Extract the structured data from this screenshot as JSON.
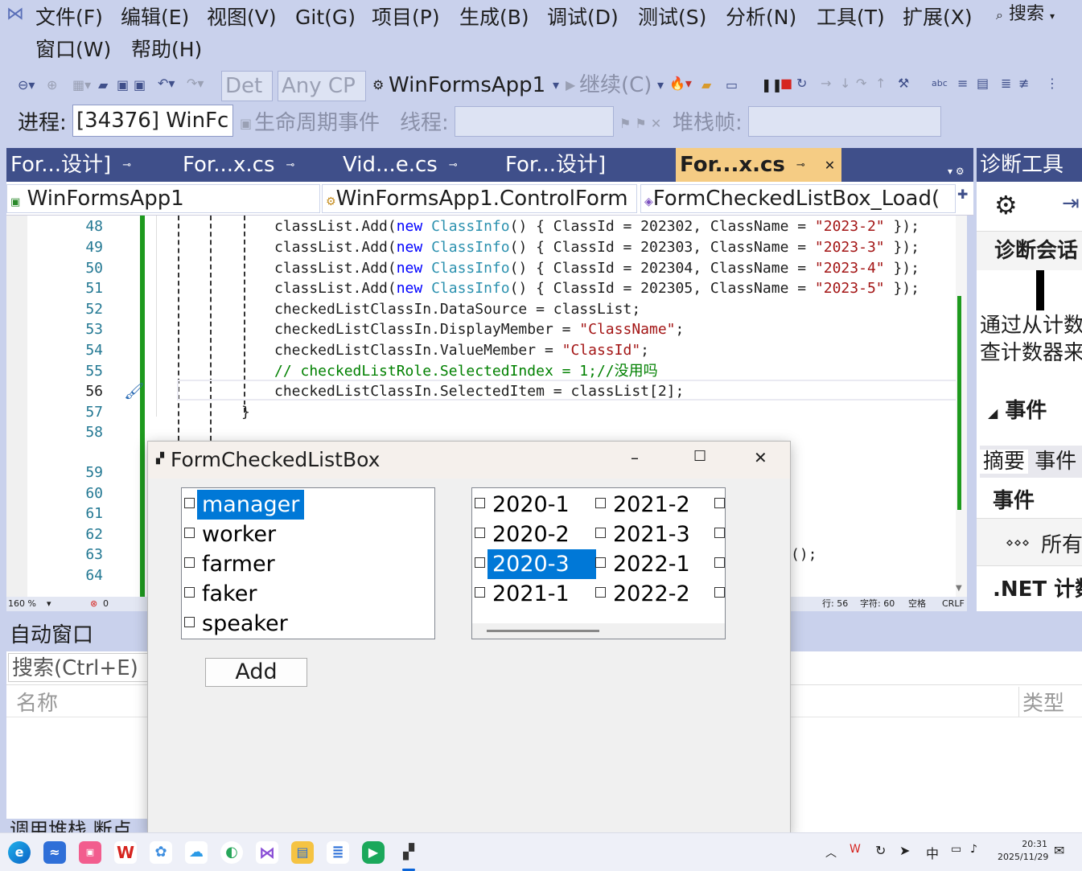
{
  "menu": {
    "items": [
      "文件(F)",
      "编辑(E)",
      "视图(V)",
      "Git(G)",
      "项目(P)",
      "生成(B)",
      "调试(D)",
      "测试(S)",
      "分析(N)",
      "工具(T)",
      "扩展(X)",
      "窗口(W)",
      "帮助(H)"
    ],
    "search": "搜索"
  },
  "toolbar": {
    "config": "Det",
    "platform": "Any CP",
    "project": "WinFormsApp1",
    "continue": "继续(C)",
    "process_label": "进程:",
    "process_value": "[34376] WinFc",
    "lifecycle": "生命周期事件",
    "thread_label": "线程:",
    "stack_label": "堆栈帧:"
  },
  "tabs": [
    {
      "label": "For...设计]"
    },
    {
      "label": "For...x.cs"
    },
    {
      "label": "Vid...e.cs"
    },
    {
      "label": "For...设计]"
    },
    {
      "label": "For...x.cs"
    }
  ],
  "nav": {
    "project": "WinFormsApp1",
    "class": "WinFormsApp1.ControlForm",
    "member": "FormCheckedListBox_Load("
  },
  "editor": {
    "line_numbers": [
      "48",
      "49",
      "50",
      "51",
      "52",
      "53",
      "54",
      "55",
      "56",
      "57",
      "58",
      "59",
      "60",
      "61",
      "62",
      "63",
      "64"
    ],
    "lines": [
      {
        "a": "classList.Add(",
        "kw": "new",
        "t": "ClassInfo",
        "b": "() { ClassId = 202302, ClassName = ",
        "s": "\"2023-2\"",
        "c": " });"
      },
      {
        "a": "classList.Add(",
        "kw": "new",
        "t": "ClassInfo",
        "b": "() { ClassId = 202303, ClassName = ",
        "s": "\"2023-3\"",
        "c": " });"
      },
      {
        "a": "classList.Add(",
        "kw": "new",
        "t": "ClassInfo",
        "b": "() { ClassId = 202304, ClassName = ",
        "s": "\"2023-4\"",
        "c": " });"
      },
      {
        "a": "classList.Add(",
        "kw": "new",
        "t": "ClassInfo",
        "b": "() { ClassId = 202305, ClassName = ",
        "s": "\"2023-5\"",
        "c": " });"
      }
    ],
    "line52": "checkedListClassIn.DataSource = classList;",
    "line53a": "checkedListClassIn.DisplayMember = ",
    "line53s": "\"ClassName\"",
    "line54a": "checkedListClassIn.ValueMember = ",
    "line54s": "\"ClassId\"",
    "line55": "// checkedListRole.SelectedIndex = 1;//没用吗",
    "line56": "checkedListClassIn.SelectedItem = classList[2];",
    "line57": "}",
    "partial_tail": "();"
  },
  "editor_status": {
    "zoom": "160 %",
    "errors": "0",
    "row": "行: 56",
    "col": "字符: 60",
    "spaces": "空格",
    "eol": "CRLF"
  },
  "diag": {
    "title": "诊断工具",
    "session": "诊断会话",
    "desc1": "通过从计数",
    "desc2": "查计数器来",
    "events_header": "事件",
    "tab_summary": "摘要",
    "tab_events": "事件",
    "events2": "事件",
    "all": "所有",
    "dotnet": ".NET 计数"
  },
  "autos": {
    "title": "自动窗口",
    "search": "搜索(Ctrl+E)",
    "col_name": "名称",
    "col_type": "类型",
    "bottom_tabs": "调用堆栈 断点"
  },
  "dialog": {
    "title": "FormCheckedListBox",
    "roles": [
      "manager",
      "worker",
      "farmer",
      "faker",
      "speaker"
    ],
    "selected_role_index": 0,
    "classes_col1": [
      "2020-1",
      "2020-2",
      "2020-3",
      "2021-1"
    ],
    "classes_col2": [
      "2021-2",
      "2021-3",
      "2022-1",
      "2022-2"
    ],
    "selected_class": "2020-3",
    "add_button": "Add"
  },
  "taskbar": {
    "time": "20:31",
    "date": "2025/11/29",
    "ime": "中"
  }
}
